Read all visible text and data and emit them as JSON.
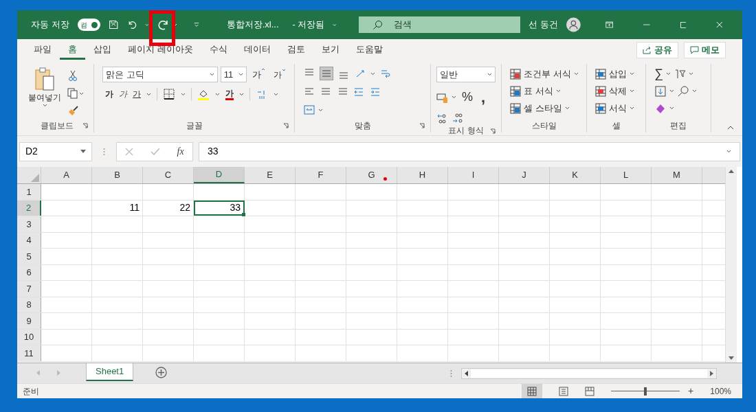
{
  "title_bar": {
    "autosave_label": "자동 저장",
    "autosave_toggle": {
      "label": "켬",
      "on": true
    },
    "file_name": "통합저장.xl...",
    "save_status": "- 저장됨",
    "search": {
      "placeholder": "검색"
    },
    "user": "선 동건"
  },
  "ribbon_tabs": [
    {
      "label": "파일",
      "selected": false
    },
    {
      "label": "홈",
      "selected": true
    },
    {
      "label": "삽입",
      "selected": false
    },
    {
      "label": "페이지 레이아웃",
      "selected": false
    },
    {
      "label": "수식",
      "selected": false
    },
    {
      "label": "데이터",
      "selected": false
    },
    {
      "label": "검토",
      "selected": false
    },
    {
      "label": "보기",
      "selected": false
    },
    {
      "label": "도움말",
      "selected": false
    }
  ],
  "share_button": "공유",
  "memo_button": "메모",
  "ribbon": {
    "clipboard": {
      "label": "클립보드",
      "paste": "붙여넣기"
    },
    "font": {
      "label": "글꼴",
      "font_name": "맑은 고딕",
      "font_size": "11",
      "grow": "가",
      "shrink": "가",
      "bold": "가",
      "italic": "가",
      "underline": "가",
      "font_color": "가"
    },
    "alignment": {
      "label": "맞춤"
    },
    "number": {
      "label": "표시 형식",
      "format": "일반",
      "percent": "%",
      "comma": ","
    },
    "styles": {
      "label": "스타일",
      "items": [
        "조건부 서식",
        "표 서식",
        "셀 스타일"
      ]
    },
    "cells": {
      "label": "셀",
      "items": [
        "삽입",
        "삭제",
        "서식"
      ]
    },
    "editing": {
      "label": "편집",
      "sum": "∑"
    }
  },
  "formula_bar": {
    "name_box": "D2",
    "fx": "fx",
    "value": "33"
  },
  "columns": [
    {
      "label": "A",
      "selected": false
    },
    {
      "label": "B",
      "selected": false
    },
    {
      "label": "C",
      "selected": false
    },
    {
      "label": "D",
      "selected": true
    },
    {
      "label": "E",
      "selected": false
    },
    {
      "label": "F",
      "selected": false
    },
    {
      "label": "G",
      "selected": false
    },
    {
      "label": "H",
      "selected": false
    },
    {
      "label": "I",
      "selected": false
    },
    {
      "label": "J",
      "selected": false
    },
    {
      "label": "K",
      "selected": false
    },
    {
      "label": "L",
      "selected": false
    },
    {
      "label": "M",
      "selected": false
    }
  ],
  "rows": [
    {
      "label": "1",
      "selected": false,
      "cells": []
    },
    {
      "label": "2",
      "selected": true,
      "cells": [
        null,
        {
          "value": "11",
          "selected": false
        },
        {
          "value": "22",
          "selected": false
        },
        {
          "value": "33",
          "selected": true
        }
      ]
    },
    {
      "label": "3",
      "selected": false,
      "cells": []
    },
    {
      "label": "4",
      "selected": false,
      "cells": []
    },
    {
      "label": "5",
      "selected": false,
      "cells": []
    },
    {
      "label": "6",
      "selected": false,
      "cells": []
    },
    {
      "label": "7",
      "selected": false,
      "cells": []
    },
    {
      "label": "8",
      "selected": false,
      "cells": []
    },
    {
      "label": "9",
      "selected": false,
      "cells": []
    },
    {
      "label": "10",
      "selected": false,
      "cells": []
    },
    {
      "label": "11",
      "selected": false,
      "cells": []
    }
  ],
  "sheet_tabs": [
    {
      "label": "Sheet1",
      "selected": true
    }
  ],
  "status_bar": {
    "status": "준비",
    "zoom_plus": "+",
    "zoom_level": {
      "level": 0.5
    },
    "zoom_value": "100%"
  }
}
